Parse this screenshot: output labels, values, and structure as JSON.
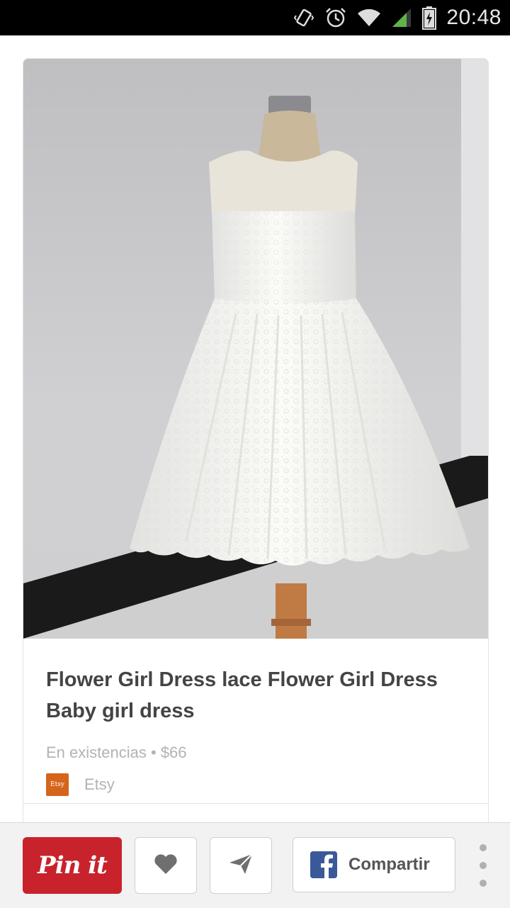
{
  "status_bar": {
    "time": "20:48",
    "icons": [
      "vibrate-icon",
      "alarm-icon",
      "wifi-icon",
      "signal-icon",
      "battery-icon"
    ]
  },
  "pin": {
    "image_alt": "Flower girl white lace dress on mannequin",
    "title": "Flower Girl Dress lace Flower Girl Dress Baby girl dress",
    "availability": "En existencias",
    "separator": "•",
    "price": "$66",
    "store": {
      "logo_text": "Etsy",
      "name": "Etsy"
    }
  },
  "actions": {
    "pinit_label": "Pin it",
    "like_icon": "heart-icon",
    "send_icon": "send-icon",
    "share_label": "Compartir",
    "share_icon": "facebook-icon",
    "more_icon": "more-vertical-icon"
  },
  "colors": {
    "pinit_red": "#c8232c",
    "facebook_blue": "#3b5998",
    "etsy_orange": "#d5641c"
  }
}
